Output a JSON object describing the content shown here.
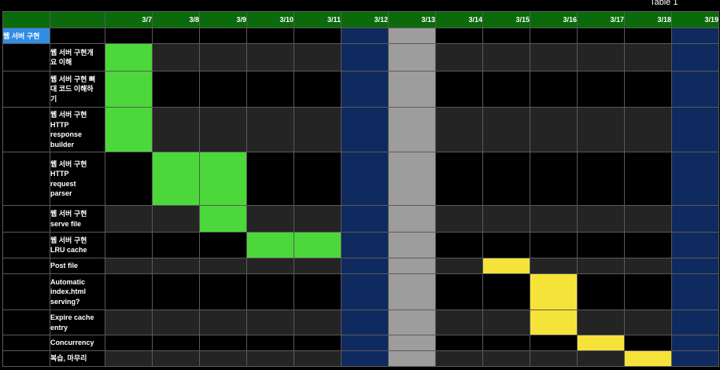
{
  "caption": "Table 1",
  "dates": [
    "3/7",
    "3/8",
    "3/9",
    "3/10",
    "3/11",
    "3/12",
    "3/13",
    "3/14",
    "3/15",
    "3/16",
    "3/17",
    "3/18",
    "3/19"
  ],
  "weekend_blue": [
    "3/12",
    "3/19"
  ],
  "weekend_grey": [
    "3/13"
  ],
  "colors": {
    "header": "#0b6a0b",
    "group": "#2f8ee6",
    "green": "#4cd83a",
    "yellow": "#f5e33a",
    "weekend_blue": "#0f2a5e",
    "weekend_grey": "#9d9d9d"
  },
  "group": {
    "label": "웹 서버 구현"
  },
  "tasks": [
    {
      "name": "웹 서버 구현개\n요 이해",
      "active": [
        "3/7"
      ],
      "color": "green",
      "height": 35
    },
    {
      "name": "웹 서버 구현 뼈\n대 코드 이해하\n기",
      "active": [
        "3/7"
      ],
      "color": "green",
      "height": 46
    },
    {
      "name": "웹 서버 구현\nHTTP\nresponse\nbuilder",
      "active": [
        "3/7"
      ],
      "color": "green",
      "height": 57
    },
    {
      "name": "웹 서버 구현\nHTTP\nrequest\nparser",
      "active": [
        "3/8",
        "3/9"
      ],
      "color": "green",
      "height": 68
    },
    {
      "name": "웹 서버 구현\nserve file",
      "active": [
        "3/9"
      ],
      "color": "green",
      "height": 34
    },
    {
      "name": "웹 서버 구현\nLRU cache",
      "active": [
        "3/10",
        "3/11"
      ],
      "color": "green",
      "height": 33
    },
    {
      "name": "Post file",
      "active": [
        "3/15"
      ],
      "color": "yellow",
      "height": 20
    },
    {
      "name": "Automatic\nindex.html\nserving?",
      "active": [
        "3/16"
      ],
      "color": "yellow",
      "height": 46
    },
    {
      "name": "Expire cache\nentry",
      "active": [
        "3/16"
      ],
      "color": "yellow",
      "height": 32
    },
    {
      "name": "Concurrency",
      "active": [
        "3/17"
      ],
      "color": "yellow",
      "height": 20
    },
    {
      "name": "복습, 마무리",
      "active": [
        "3/18"
      ],
      "color": "yellow",
      "height": 20
    }
  ]
}
